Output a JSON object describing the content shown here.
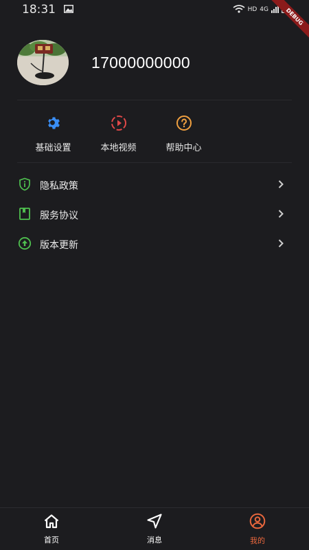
{
  "status_bar": {
    "time": "18:31",
    "hd": "HD",
    "network": "4G"
  },
  "debug_banner": "DEBUG",
  "profile": {
    "phone": "17000000000"
  },
  "quick_actions": [
    {
      "label": "基础设置",
      "icon": "gear-icon",
      "color": "#3a8ef5"
    },
    {
      "label": "本地视频",
      "icon": "play-circle-icon",
      "color": "#e04848"
    },
    {
      "label": "帮助中心",
      "icon": "help-circle-icon",
      "color": "#f0a040"
    }
  ],
  "menu": [
    {
      "label": "隐私政策",
      "icon": "shield-info-icon",
      "color": "#4fc04f"
    },
    {
      "label": "服务协议",
      "icon": "bookmark-book-icon",
      "color": "#4fc04f"
    },
    {
      "label": "版本更新",
      "icon": "upload-circle-icon",
      "color": "#4fc04f"
    }
  ],
  "bottom_nav": [
    {
      "label": "首页",
      "icon": "home-icon"
    },
    {
      "label": "消息",
      "icon": "send-icon"
    },
    {
      "label": "我的",
      "icon": "user-circle-icon",
      "active": true,
      "color": "#e9673d"
    }
  ]
}
